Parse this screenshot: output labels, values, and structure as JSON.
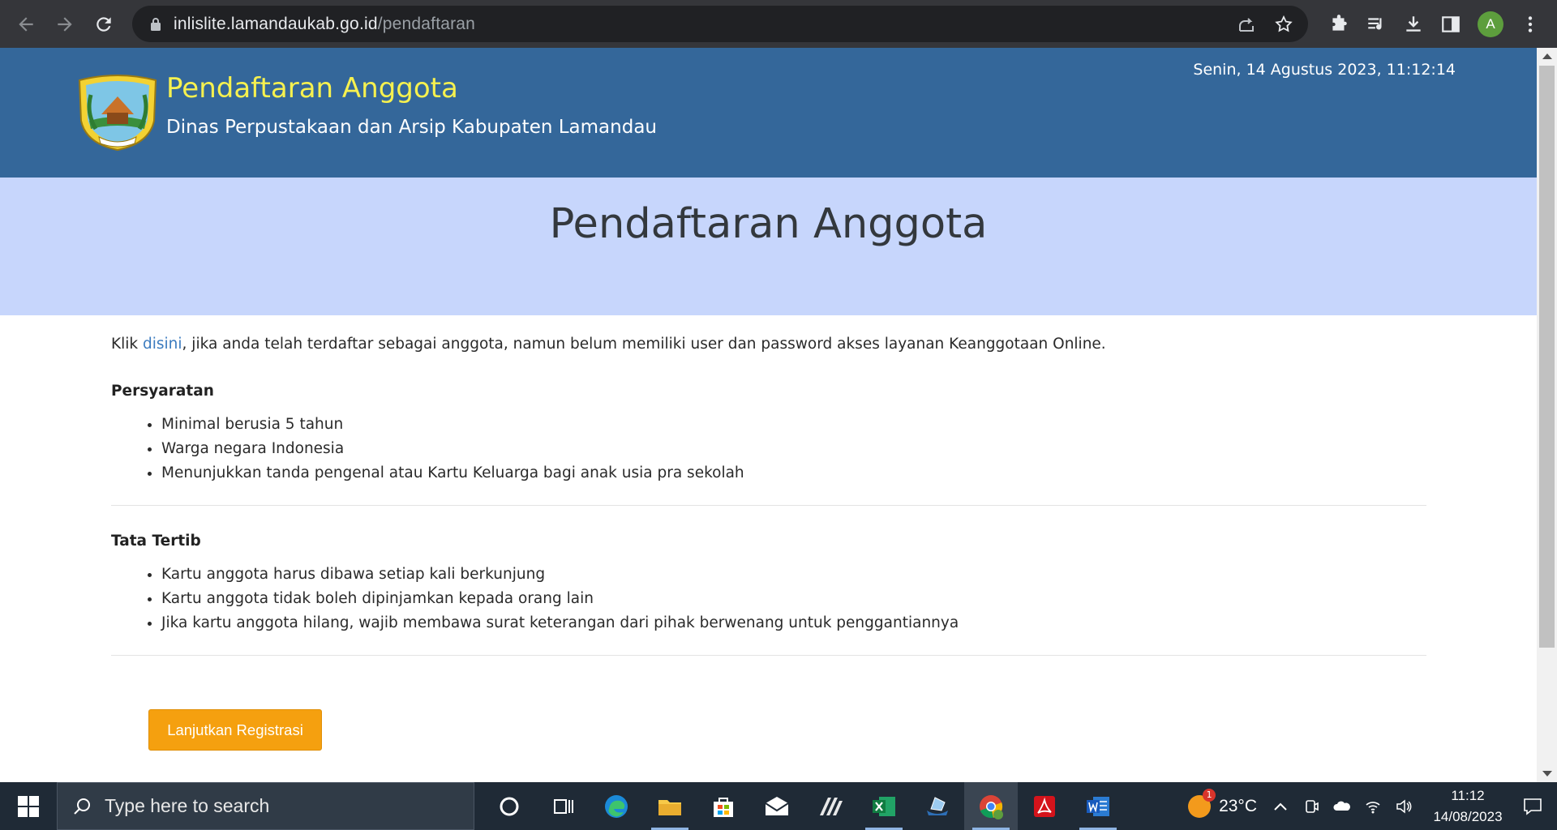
{
  "browser": {
    "url_host": "inlislite.lamandaukab.go.id",
    "url_path": "/pendaftaran",
    "profile_initial": "A"
  },
  "header": {
    "title": "Pendaftaran Anggota",
    "subtitle": "Dinas Perpustakaan dan Arsip Kabupaten Lamandau",
    "datetime": "Senin, 14 Agustus 2023, 11:12:14"
  },
  "hero": {
    "title": "Pendaftaran Anggota"
  },
  "intro": {
    "prefix": "Klik ",
    "link": "disini",
    "suffix": ", jika anda telah terdaftar sebagai anggota, namun belum memiliki user dan password akses layanan Keanggotaan Online."
  },
  "requirements": {
    "heading": "Persyaratan",
    "items": [
      "Minimal berusia 5 tahun",
      "Warga negara Indonesia",
      "Menunjukkan tanda pengenal atau Kartu Keluarga bagi anak usia pra sekolah"
    ]
  },
  "rules": {
    "heading": "Tata Tertib",
    "items": [
      "Kartu anggota harus dibawa setiap kali berkunjung",
      "Kartu anggota tidak boleh dipinjamkan kepada orang lain",
      "Jika kartu anggota hilang, wajib membawa surat keterangan dari pihak berwenang untuk penggantiannya"
    ]
  },
  "cta": {
    "label": "Lanjutkan Registrasi"
  },
  "taskbar": {
    "search_placeholder": "Type here to search",
    "weather_temp": "23°C",
    "weather_badge": "1",
    "time": "11:12",
    "date": "14/08/2023"
  },
  "colors": {
    "header_bg": "#34679a",
    "title_yellow": "#f6f14f",
    "hero_bg": "#c7d6fc",
    "cta_bg": "#f5a00f",
    "link": "#3b7bbf"
  }
}
